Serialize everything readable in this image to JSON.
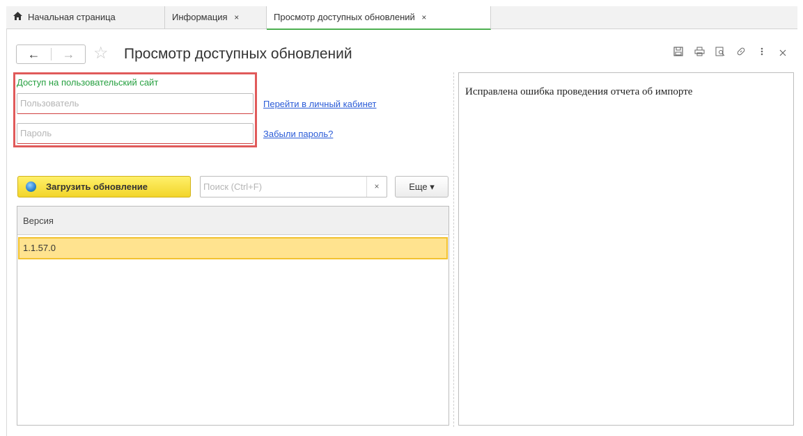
{
  "tabs": [
    {
      "label": "Начальная страница",
      "icon": "home-icon",
      "closable": false,
      "active": false
    },
    {
      "label": "Информация",
      "closable": true,
      "active": false
    },
    {
      "label": "Просмотр доступных обновлений",
      "closable": true,
      "active": true
    }
  ],
  "tab_close_glyph": "×",
  "header": {
    "back_glyph": "←",
    "forward_glyph": "→",
    "star_glyph": "☆",
    "title": "Просмотр доступных обновлений",
    "tools": [
      "save-icon",
      "print-icon",
      "preview-icon",
      "link-icon",
      "more-vertical-icon",
      "close-icon"
    ]
  },
  "login": {
    "group_title": "Доступ на пользовательский сайт",
    "user_placeholder": "Пользователь",
    "password_placeholder": "Пароль",
    "cabinet_link": "Перейти в личный кабинет",
    "forgot_link": "Забыли пароль?"
  },
  "commands": {
    "load_button": "Загрузить обновление",
    "search_placeholder": "Поиск (Ctrl+F)",
    "clear_glyph": "×",
    "more_button": "Еще ▾"
  },
  "table": {
    "header": "Версия",
    "rows": [
      "1.1.57.0"
    ]
  },
  "description": "Исправлена ошибка проведения отчета об импорте",
  "colors": {
    "accent_green": "#4caf50",
    "group_title": "#26a040",
    "highlight_box": "#e05a5a",
    "selected_row": "#ffe38f",
    "load_button": "#f2d52a",
    "link": "#2a5bd7"
  }
}
